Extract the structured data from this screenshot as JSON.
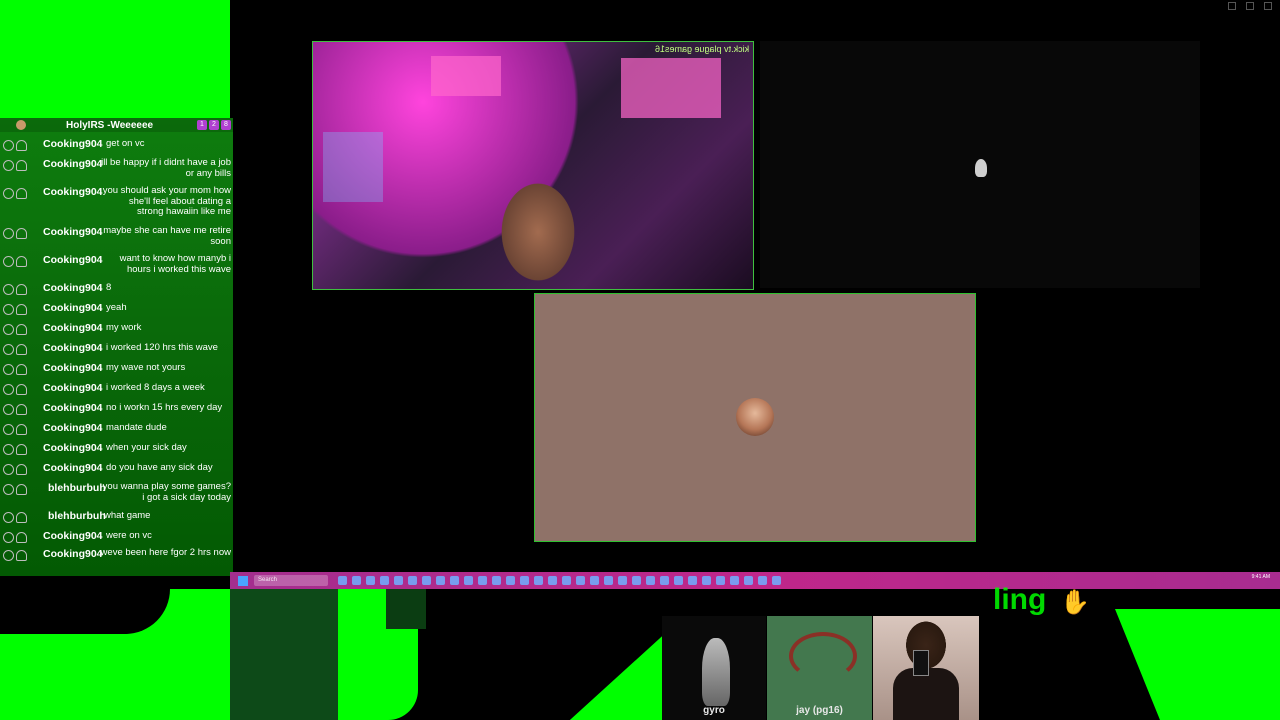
{
  "chat": {
    "header_name": "HolyIRS -Weeeeee",
    "header_badges": [
      "1",
      "2",
      "8"
    ],
    "messages": [
      {
        "user": "Cooking904",
        "text": "get on vc"
      },
      {
        "user": "Cooking904",
        "text": "ill be happy if i didnt have a job or any bills"
      },
      {
        "user": "Cooking904",
        "text": "you should ask your mom how she'll feel about dating a strong hawaiin like me"
      },
      {
        "user": "Cooking904",
        "text": "maybe she can have me retire soon"
      },
      {
        "user": "Cooking904",
        "text": "want to know how manyb i hours i worked this wave"
      },
      {
        "user": "Cooking904",
        "text": "8"
      },
      {
        "user": "Cooking904",
        "text": "yeah"
      },
      {
        "user": "Cooking904",
        "text": "my work"
      },
      {
        "user": "Cooking904",
        "text": "i worked 120 hrs this wave"
      },
      {
        "user": "Cooking904",
        "text": "my wave not yours"
      },
      {
        "user": "Cooking904",
        "text": "i worked 8 days a week"
      },
      {
        "user": "Cooking904",
        "text": "no i workn 15 hrs every day"
      },
      {
        "user": "Cooking904",
        "text": "mandate dude"
      },
      {
        "user": "Cooking904",
        "text": "when your sick day"
      },
      {
        "user": "Cooking904",
        "text": "do you have any sick day"
      },
      {
        "user": "blehburbuh",
        "text": "you wanna play some games? i got a sick day today"
      },
      {
        "user": "blehburbuh",
        "text": "what game"
      },
      {
        "user": "Cooking904",
        "text": "were on vc"
      },
      {
        "user": "Cooking904",
        "text": "weve been here fgor 2 hrs now"
      }
    ]
  },
  "stream": {
    "watermark": "kick.tv plague games16"
  },
  "taskbar": {
    "search_placeholder": "Search",
    "tray_text": "9:41 AM"
  },
  "participants": [
    {
      "name": "gyro"
    },
    {
      "name": "jay (pg16)"
    }
  ],
  "overlay": {
    "text": "ling"
  },
  "colors": {
    "chroma_green": "#00ff00",
    "taskbar": "#c0268a",
    "call_tile": "#8f7268"
  }
}
